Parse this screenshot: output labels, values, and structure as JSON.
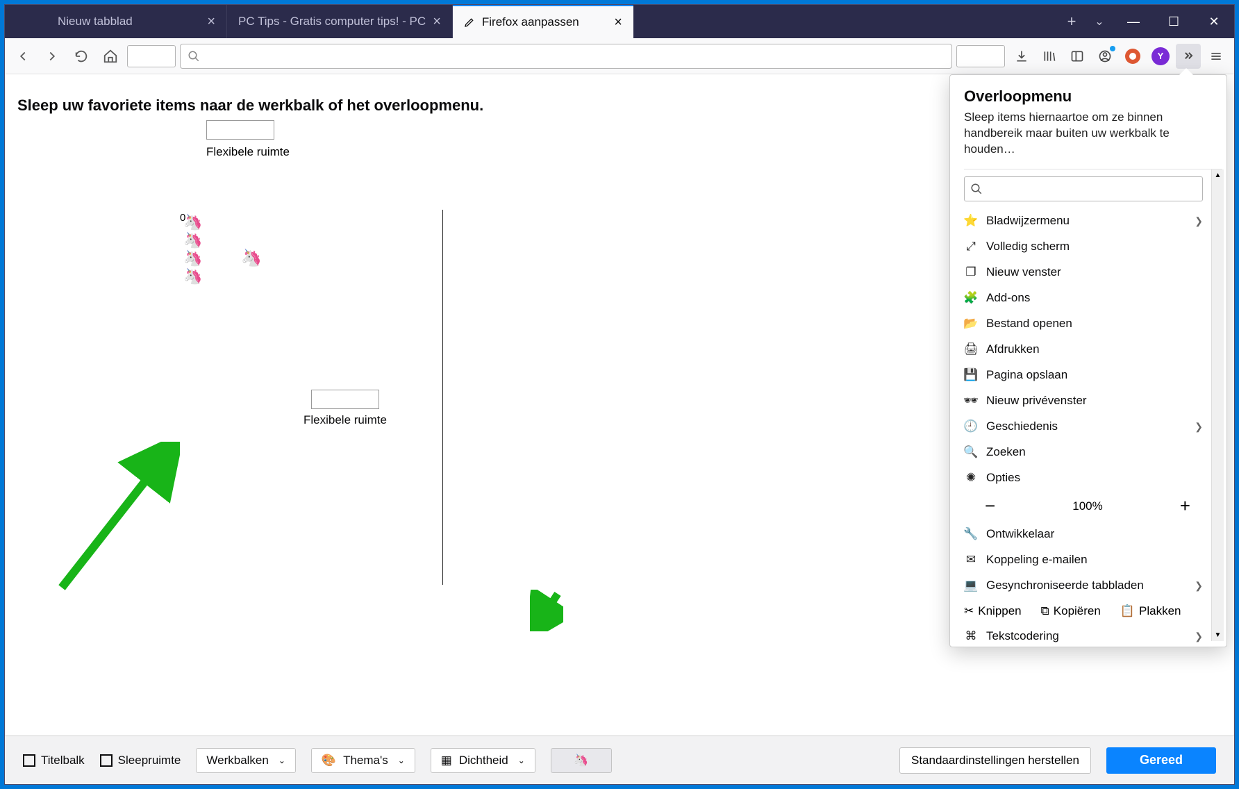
{
  "tabs": [
    {
      "title": "Nieuw tabblad"
    },
    {
      "title": "PC Tips - Gratis computer tips! - PC"
    },
    {
      "title": "Firefox aanpassen",
      "active": true
    }
  ],
  "heading": "Sleep uw favoriete items naar de werkbalk of het overloopmenu.",
  "flex1_label": "Flexibele ruimte",
  "flex2_label": "Flexibele ruimte",
  "zero": "0",
  "overflow": {
    "title": "Overloopmenu",
    "desc": "Sleep items hiernaartoe om ze binnen handbereik maar buiten uw werkbalk te houden…",
    "items": [
      {
        "label": "Bladwijzermenu",
        "icon": "star",
        "chev": true
      },
      {
        "label": "Volledig scherm",
        "icon": "expand"
      },
      {
        "label": "Nieuw venster",
        "icon": "window"
      },
      {
        "label": "Add-ons",
        "icon": "puzzle"
      },
      {
        "label": "Bestand openen",
        "icon": "folder"
      },
      {
        "label": "Afdrukken",
        "icon": "print"
      },
      {
        "label": "Pagina opslaan",
        "icon": "save"
      },
      {
        "label": "Nieuw privévenster",
        "icon": "mask"
      },
      {
        "label": "Geschiedenis",
        "icon": "clock",
        "chev": true
      },
      {
        "label": "Zoeken",
        "icon": "search"
      },
      {
        "label": "Opties",
        "icon": "gear"
      }
    ],
    "zoom_minus": "−",
    "zoom_value": "100%",
    "zoom_plus": "+",
    "items2": [
      {
        "label": "Ontwikkelaar",
        "icon": "wrench"
      },
      {
        "label": "Koppeling e-mailen",
        "icon": "mail"
      },
      {
        "label": "Gesynchroniseerde tabbladen",
        "icon": "laptop",
        "chev": true
      }
    ],
    "cut": "Knippen",
    "copy": "Kopiëren",
    "paste": "Plakken",
    "encoding": {
      "label": "Tekstcodering",
      "icon": "encoding",
      "chev": true
    }
  },
  "footer": {
    "titlebar": "Titelbalk",
    "dragspace": "Sleepruimte",
    "toolbars": "Werkbalken",
    "themes": "Thema's",
    "density": "Dichtheid",
    "restore": "Standaardinstellingen herstellen",
    "done": "Gereed"
  },
  "avatar_letter": "Y"
}
